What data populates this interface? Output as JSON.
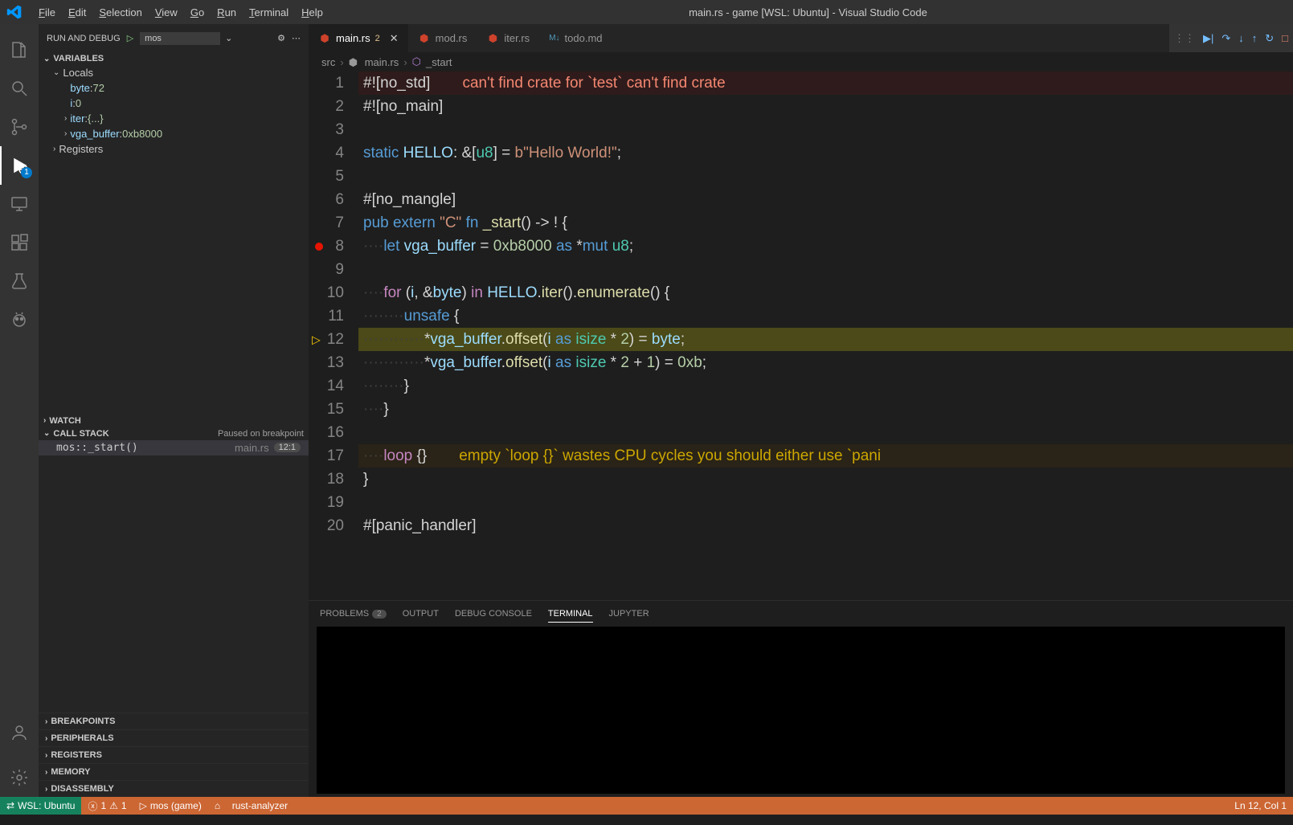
{
  "menubar": {
    "items": [
      "File",
      "Edit",
      "Selection",
      "View",
      "Go",
      "Run",
      "Terminal",
      "Help"
    ]
  },
  "title": "main.rs - game [WSL: Ubuntu] - Visual Studio Code",
  "activitybar": {
    "debug_badge": "1"
  },
  "sidebar": {
    "title": "RUN AND DEBUG",
    "config": "mos",
    "sections": {
      "variables": {
        "label": "VARIABLES",
        "locals_label": "Locals",
        "locals": [
          {
            "k": "byte",
            "sep": ": ",
            "v": "72"
          },
          {
            "k": "i",
            "sep": ": ",
            "v": "0"
          },
          {
            "k": "iter",
            "sep": ": ",
            "v": "{...}",
            "expand": true
          },
          {
            "k": "vga_buffer",
            "sep": ": ",
            "v": "0xb8000",
            "expand": true
          }
        ],
        "registers_label": "Registers"
      },
      "watch": {
        "label": "WATCH"
      },
      "callstack": {
        "label": "CALL STACK",
        "status": "Paused on breakpoint",
        "frame": {
          "name": "mos::_start()",
          "file": "main.rs",
          "loc": "12:1"
        }
      },
      "breakpoints": {
        "label": "BREAKPOINTS"
      },
      "peripherals": {
        "label": "PERIPHERALS"
      },
      "registers": {
        "label": "REGISTERS"
      },
      "memory": {
        "label": "MEMORY"
      },
      "disassembly": {
        "label": "DISASSEMBLY"
      }
    }
  },
  "tabs": [
    {
      "name": "main.rs",
      "dirty": "2",
      "active": true,
      "icon": "rust"
    },
    {
      "name": "mod.rs",
      "icon": "rust"
    },
    {
      "name": "iter.rs",
      "icon": "rust"
    },
    {
      "name": "todo.md",
      "icon": "md"
    }
  ],
  "breadcrumb": {
    "items": [
      "src",
      "main.rs",
      "_start"
    ]
  },
  "code": {
    "lines": [
      {
        "n": 1,
        "err": true,
        "segs": [
          [
            "plain",
            "#!["
          ],
          [
            "attr",
            "no_std"
          ],
          [
            "plain",
            "]"
          ]
        ],
        "trail": "can't find crate for `test` can't find crate"
      },
      {
        "n": 2,
        "segs": [
          [
            "plain",
            "#!["
          ],
          [
            "attr",
            "no_main"
          ],
          [
            "plain",
            "]"
          ]
        ]
      },
      {
        "n": 3,
        "segs": []
      },
      {
        "n": 4,
        "segs": [
          [
            "kw",
            "static"
          ],
          [
            "plain",
            " "
          ],
          [
            "ident",
            "HELLO"
          ],
          [
            "plain",
            ": &["
          ],
          [
            "type",
            "u8"
          ],
          [
            "plain",
            "] = "
          ],
          [
            "str",
            "b\"Hello World!\""
          ],
          [
            "plain",
            ";"
          ]
        ]
      },
      {
        "n": 5,
        "segs": []
      },
      {
        "n": 6,
        "segs": [
          [
            "plain",
            "#["
          ],
          [
            "attr",
            "no_mangle"
          ],
          [
            "plain",
            "]"
          ]
        ]
      },
      {
        "n": 7,
        "segs": [
          [
            "kw",
            "pub"
          ],
          [
            "plain",
            " "
          ],
          [
            "kw",
            "extern"
          ],
          [
            "plain",
            " "
          ],
          [
            "str",
            "\"C\""
          ],
          [
            "plain",
            " "
          ],
          [
            "kw",
            "fn"
          ],
          [
            "plain",
            " "
          ],
          [
            "fn",
            "_start"
          ],
          [
            "plain",
            "() -> ! {"
          ]
        ]
      },
      {
        "n": 8,
        "bp": true,
        "ws": "····",
        "segs": [
          [
            "kw",
            "let"
          ],
          [
            "plain",
            " "
          ],
          [
            "ident",
            "vga_buffer"
          ],
          [
            "plain",
            " = "
          ],
          [
            "num",
            "0xb8000"
          ],
          [
            "plain",
            " "
          ],
          [
            "kw",
            "as"
          ],
          [
            "plain",
            " *"
          ],
          [
            "kw",
            "mut"
          ],
          [
            "plain",
            " "
          ],
          [
            "type",
            "u8"
          ],
          [
            "plain",
            ";"
          ]
        ]
      },
      {
        "n": 9,
        "segs": []
      },
      {
        "n": 10,
        "ws": "····",
        "segs": [
          [
            "kw2",
            "for"
          ],
          [
            "plain",
            " ("
          ],
          [
            "ident",
            "i"
          ],
          [
            "plain",
            ", &"
          ],
          [
            "ident",
            "byte"
          ],
          [
            "plain",
            ") "
          ],
          [
            "kw2",
            "in"
          ],
          [
            "plain",
            " "
          ],
          [
            "ident",
            "HELLO"
          ],
          [
            "plain",
            "."
          ],
          [
            "fn",
            "iter"
          ],
          [
            "plain",
            "()."
          ],
          [
            "fn",
            "enumerate"
          ],
          [
            "plain",
            "() {"
          ]
        ]
      },
      {
        "n": 11,
        "ws": "········",
        "segs": [
          [
            "kw",
            "unsafe"
          ],
          [
            "plain",
            " "
          ],
          [
            "plain",
            "{"
          ]
        ]
      },
      {
        "n": 12,
        "cur": true,
        "hl": true,
        "ws": "············",
        "segs": [
          [
            "plain",
            "*"
          ],
          [
            "ident",
            "vga_buffer"
          ],
          [
            "plain",
            "."
          ],
          [
            "fn",
            "offset"
          ],
          [
            "plain",
            "("
          ],
          [
            "ident",
            "i"
          ],
          [
            "plain",
            " "
          ],
          [
            "kw",
            "as"
          ],
          [
            "plain",
            " "
          ],
          [
            "type",
            "isize"
          ],
          [
            "plain",
            " * "
          ],
          [
            "num",
            "2"
          ],
          [
            "plain",
            ") = "
          ],
          [
            "ident",
            "byte"
          ],
          [
            "plain",
            ";"
          ]
        ]
      },
      {
        "n": 13,
        "ws": "············",
        "segs": [
          [
            "plain",
            "*"
          ],
          [
            "ident",
            "vga_buffer"
          ],
          [
            "plain",
            "."
          ],
          [
            "fn",
            "offset"
          ],
          [
            "plain",
            "("
          ],
          [
            "ident",
            "i"
          ],
          [
            "plain",
            " "
          ],
          [
            "kw",
            "as"
          ],
          [
            "plain",
            " "
          ],
          [
            "type",
            "isize"
          ],
          [
            "plain",
            " * "
          ],
          [
            "num",
            "2"
          ],
          [
            "plain",
            " + "
          ],
          [
            "num",
            "1"
          ],
          [
            "plain",
            ") = "
          ],
          [
            "num",
            "0xb"
          ],
          [
            "plain",
            ";"
          ]
        ]
      },
      {
        "n": 14,
        "ws": "········",
        "segs": [
          [
            "plain",
            "}"
          ]
        ]
      },
      {
        "n": 15,
        "ws": "····",
        "segs": [
          [
            "plain",
            "}"
          ]
        ]
      },
      {
        "n": 16,
        "segs": []
      },
      {
        "n": 17,
        "warn": true,
        "ws": "····",
        "segs": [
          [
            "kw2",
            "loop"
          ],
          [
            "plain",
            " "
          ],
          [
            "plain",
            "{}"
          ]
        ],
        "trail": "empty `loop {}` wastes CPU cycles you should either use `pani"
      },
      {
        "n": 18,
        "segs": [
          [
            "plain",
            "}"
          ]
        ]
      },
      {
        "n": 19,
        "segs": []
      },
      {
        "n": 20,
        "segs": [
          [
            "plain",
            "#["
          ],
          [
            "attr",
            "panic_handler"
          ],
          [
            "plain",
            "]"
          ]
        ]
      }
    ]
  },
  "panel": {
    "tabs": [
      {
        "label": "PROBLEMS",
        "badge": "2"
      },
      {
        "label": "OUTPUT"
      },
      {
        "label": "DEBUG CONSOLE"
      },
      {
        "label": "TERMINAL",
        "active": true
      },
      {
        "label": "JUPYTER"
      }
    ]
  },
  "status": {
    "wsl": "WSL: Ubuntu",
    "errors": "1",
    "warnings": "1",
    "config": "mos (game)",
    "analyzer": "rust-analyzer",
    "pos": "Ln 12, Col 1"
  }
}
